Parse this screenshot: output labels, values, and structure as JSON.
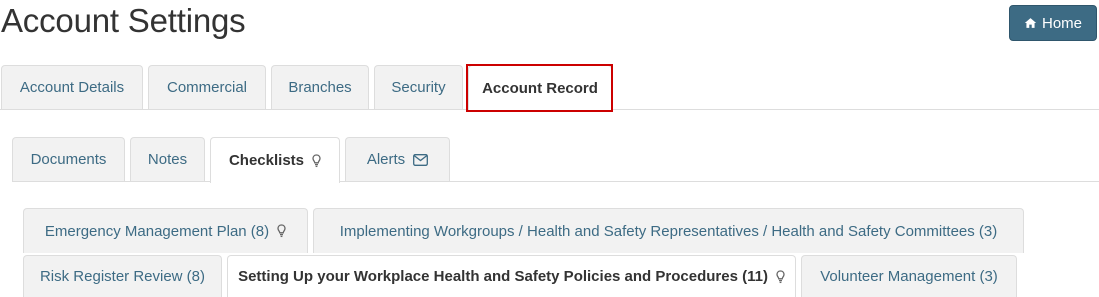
{
  "page": {
    "title": "Account Settings"
  },
  "header": {
    "home_label": "Home",
    "home_icon": "home-icon"
  },
  "main_tabs": [
    {
      "label": "Account Details"
    },
    {
      "label": "Commercial"
    },
    {
      "label": "Branches"
    },
    {
      "label": "Security"
    },
    {
      "label": "Account Record",
      "active": true,
      "highlighted": true
    }
  ],
  "record_tabs": [
    {
      "label": "Documents"
    },
    {
      "label": "Notes"
    },
    {
      "label": "Checklists",
      "active": true,
      "icon": "lightbulb-icon"
    },
    {
      "label": "Alerts",
      "icon": "envelope-icon"
    }
  ],
  "checklist_tabs": [
    {
      "label": "Emergency Management Plan (8)",
      "icon": "lightbulb-icon"
    },
    {
      "label": "Implementing Workgroups / Health and Safety Representatives / Health and Safety Committees (3)"
    },
    {
      "label": "Risk Register Review (8)"
    },
    {
      "label": "Setting Up your Workplace Health and Safety Policies and Procedures (11)",
      "active": true,
      "icon": "lightbulb-icon"
    },
    {
      "label": "Volunteer Management (3)"
    }
  ],
  "colors": {
    "accent": "#3d6b84",
    "highlight": "#cc0000",
    "tab_bg": "#f2f2f2",
    "border": "#dddddd"
  }
}
